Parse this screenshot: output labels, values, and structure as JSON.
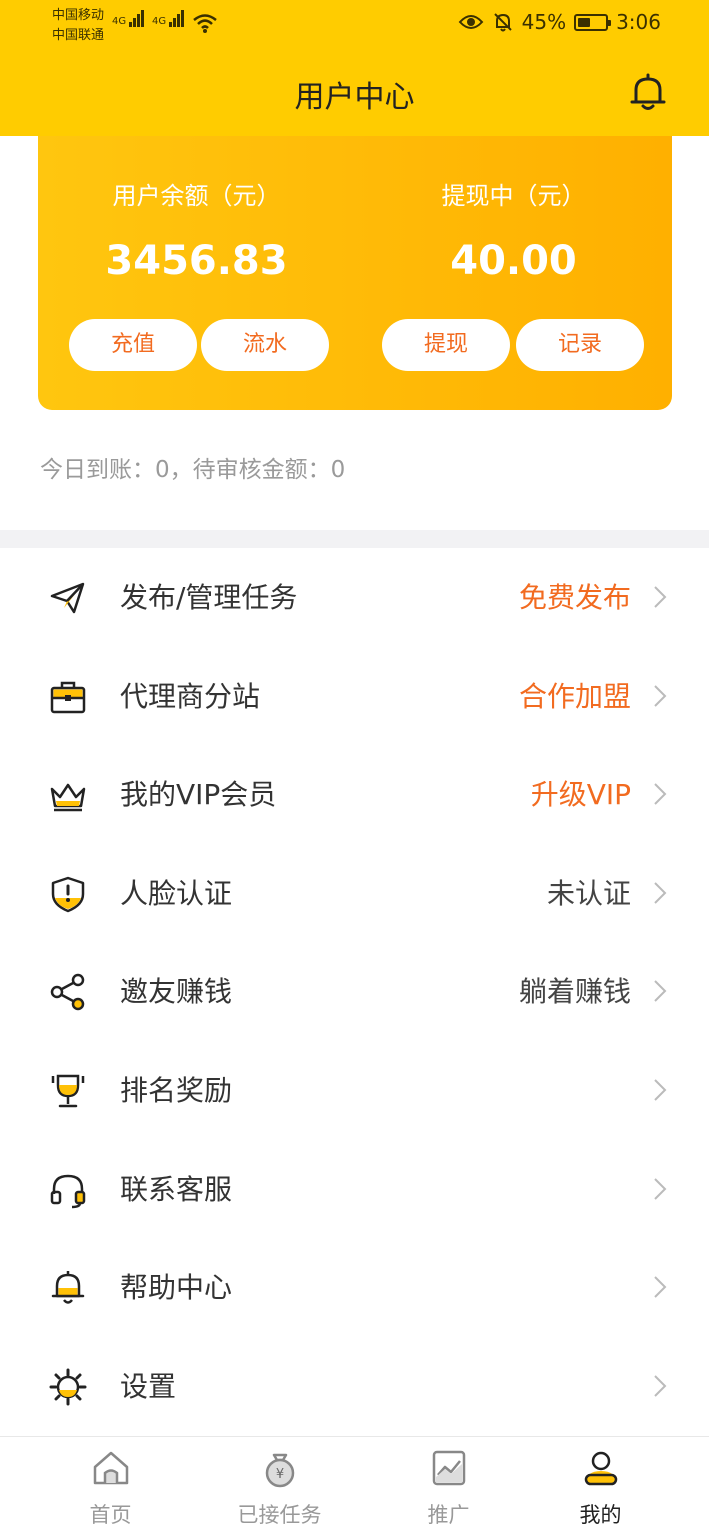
{
  "status_bar": {
    "carrier_1": "中国移动",
    "carrier_2": "中国联通",
    "net_1": "4G",
    "net_2": "4G",
    "battery_percent": "45%",
    "battery_level": 0.45,
    "time": "3:06"
  },
  "header": {
    "title": "用户中心",
    "bell_icon": "bell-icon"
  },
  "balance_card": {
    "balance_label": "用户余额（元）",
    "balance_value": "3456.83",
    "withdrawing_label": "提现中（元）",
    "withdrawing_value": "40.00",
    "buttons": {
      "recharge": "充值",
      "flow": "流水",
      "withdraw": "提现",
      "records": "记录"
    }
  },
  "today_summary": "今日到账：0，待审核金额：0",
  "menu": [
    {
      "label": "发布/管理任务",
      "hint": "免费发布",
      "icon": "paper-plane-icon"
    },
    {
      "label": "代理商分站",
      "hint": "合作加盟",
      "icon": "briefcase-icon"
    },
    {
      "label": "我的VIP会员",
      "hint": "升级VIP",
      "icon": "crown-icon"
    },
    {
      "label": "人脸认证",
      "hint": "未认证",
      "icon": "shield-icon"
    },
    {
      "label": "邀友赚钱",
      "hint": "躺着赚钱",
      "icon": "share-icon"
    },
    {
      "label": "排名奖励",
      "hint": "",
      "icon": "trophy-icon"
    },
    {
      "label": "联系客服",
      "hint": "",
      "icon": "headset-icon"
    },
    {
      "label": "帮助中心",
      "hint": "",
      "icon": "help-bell-icon"
    },
    {
      "label": "设置",
      "hint": "",
      "icon": "gear-icon"
    }
  ],
  "tabs": [
    {
      "label": "首页",
      "icon": "home-icon"
    },
    {
      "label": "已接任务",
      "icon": "money-bag-icon"
    },
    {
      "label": "推广",
      "icon": "chart-icon"
    },
    {
      "label": "我的",
      "icon": "user-icon"
    }
  ],
  "colors": {
    "brand_yellow": "#FFCC00",
    "accent_orange": "#F26B20"
  }
}
